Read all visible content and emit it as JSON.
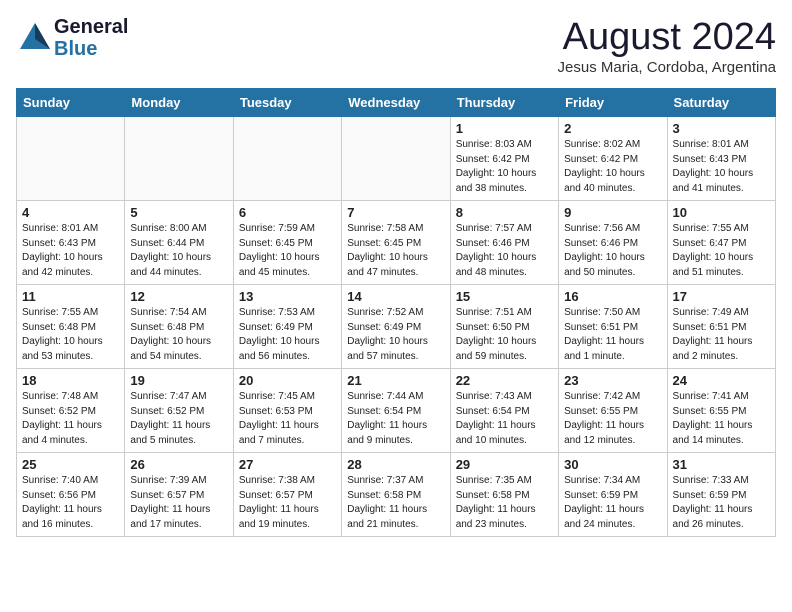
{
  "header": {
    "logo_general": "General",
    "logo_blue": "Blue",
    "month": "August 2024",
    "location": "Jesus Maria, Cordoba, Argentina"
  },
  "days_of_week": [
    "Sunday",
    "Monday",
    "Tuesday",
    "Wednesday",
    "Thursday",
    "Friday",
    "Saturday"
  ],
  "weeks": [
    [
      {
        "day": "",
        "text": ""
      },
      {
        "day": "",
        "text": ""
      },
      {
        "day": "",
        "text": ""
      },
      {
        "day": "",
        "text": ""
      },
      {
        "day": "1",
        "text": "Sunrise: 8:03 AM\nSunset: 6:42 PM\nDaylight: 10 hours\nand 38 minutes."
      },
      {
        "day": "2",
        "text": "Sunrise: 8:02 AM\nSunset: 6:42 PM\nDaylight: 10 hours\nand 40 minutes."
      },
      {
        "day": "3",
        "text": "Sunrise: 8:01 AM\nSunset: 6:43 PM\nDaylight: 10 hours\nand 41 minutes."
      }
    ],
    [
      {
        "day": "4",
        "text": "Sunrise: 8:01 AM\nSunset: 6:43 PM\nDaylight: 10 hours\nand 42 minutes."
      },
      {
        "day": "5",
        "text": "Sunrise: 8:00 AM\nSunset: 6:44 PM\nDaylight: 10 hours\nand 44 minutes."
      },
      {
        "day": "6",
        "text": "Sunrise: 7:59 AM\nSunset: 6:45 PM\nDaylight: 10 hours\nand 45 minutes."
      },
      {
        "day": "7",
        "text": "Sunrise: 7:58 AM\nSunset: 6:45 PM\nDaylight: 10 hours\nand 47 minutes."
      },
      {
        "day": "8",
        "text": "Sunrise: 7:57 AM\nSunset: 6:46 PM\nDaylight: 10 hours\nand 48 minutes."
      },
      {
        "day": "9",
        "text": "Sunrise: 7:56 AM\nSunset: 6:46 PM\nDaylight: 10 hours\nand 50 minutes."
      },
      {
        "day": "10",
        "text": "Sunrise: 7:55 AM\nSunset: 6:47 PM\nDaylight: 10 hours\nand 51 minutes."
      }
    ],
    [
      {
        "day": "11",
        "text": "Sunrise: 7:55 AM\nSunset: 6:48 PM\nDaylight: 10 hours\nand 53 minutes."
      },
      {
        "day": "12",
        "text": "Sunrise: 7:54 AM\nSunset: 6:48 PM\nDaylight: 10 hours\nand 54 minutes."
      },
      {
        "day": "13",
        "text": "Sunrise: 7:53 AM\nSunset: 6:49 PM\nDaylight: 10 hours\nand 56 minutes."
      },
      {
        "day": "14",
        "text": "Sunrise: 7:52 AM\nSunset: 6:49 PM\nDaylight: 10 hours\nand 57 minutes."
      },
      {
        "day": "15",
        "text": "Sunrise: 7:51 AM\nSunset: 6:50 PM\nDaylight: 10 hours\nand 59 minutes."
      },
      {
        "day": "16",
        "text": "Sunrise: 7:50 AM\nSunset: 6:51 PM\nDaylight: 11 hours\nand 1 minute."
      },
      {
        "day": "17",
        "text": "Sunrise: 7:49 AM\nSunset: 6:51 PM\nDaylight: 11 hours\nand 2 minutes."
      }
    ],
    [
      {
        "day": "18",
        "text": "Sunrise: 7:48 AM\nSunset: 6:52 PM\nDaylight: 11 hours\nand 4 minutes."
      },
      {
        "day": "19",
        "text": "Sunrise: 7:47 AM\nSunset: 6:52 PM\nDaylight: 11 hours\nand 5 minutes."
      },
      {
        "day": "20",
        "text": "Sunrise: 7:45 AM\nSunset: 6:53 PM\nDaylight: 11 hours\nand 7 minutes."
      },
      {
        "day": "21",
        "text": "Sunrise: 7:44 AM\nSunset: 6:54 PM\nDaylight: 11 hours\nand 9 minutes."
      },
      {
        "day": "22",
        "text": "Sunrise: 7:43 AM\nSunset: 6:54 PM\nDaylight: 11 hours\nand 10 minutes."
      },
      {
        "day": "23",
        "text": "Sunrise: 7:42 AM\nSunset: 6:55 PM\nDaylight: 11 hours\nand 12 minutes."
      },
      {
        "day": "24",
        "text": "Sunrise: 7:41 AM\nSunset: 6:55 PM\nDaylight: 11 hours\nand 14 minutes."
      }
    ],
    [
      {
        "day": "25",
        "text": "Sunrise: 7:40 AM\nSunset: 6:56 PM\nDaylight: 11 hours\nand 16 minutes."
      },
      {
        "day": "26",
        "text": "Sunrise: 7:39 AM\nSunset: 6:57 PM\nDaylight: 11 hours\nand 17 minutes."
      },
      {
        "day": "27",
        "text": "Sunrise: 7:38 AM\nSunset: 6:57 PM\nDaylight: 11 hours\nand 19 minutes."
      },
      {
        "day": "28",
        "text": "Sunrise: 7:37 AM\nSunset: 6:58 PM\nDaylight: 11 hours\nand 21 minutes."
      },
      {
        "day": "29",
        "text": "Sunrise: 7:35 AM\nSunset: 6:58 PM\nDaylight: 11 hours\nand 23 minutes."
      },
      {
        "day": "30",
        "text": "Sunrise: 7:34 AM\nSunset: 6:59 PM\nDaylight: 11 hours\nand 24 minutes."
      },
      {
        "day": "31",
        "text": "Sunrise: 7:33 AM\nSunset: 6:59 PM\nDaylight: 11 hours\nand 26 minutes."
      }
    ]
  ]
}
